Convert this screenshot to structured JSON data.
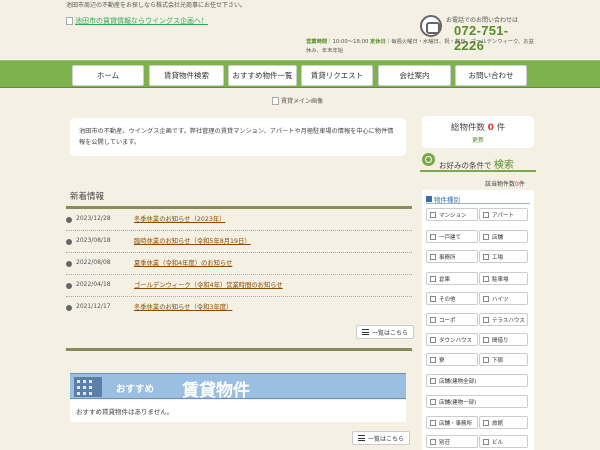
{
  "header": {
    "tagline": "池田市周辺の不動産をお探しなら株式会社光商事にお任せ下さい。",
    "logo_alt": "池田市の賃貸情報ならウイングス企画へ！",
    "phone_label": "お電話でのお問い合わせは",
    "phone_number": "072-751-2226",
    "hours_label": "営業時間",
    "hours_value": "10:00～18:00",
    "closed_label": "定休日",
    "closed_value": "毎週火曜日・水曜日、祝・祭日、ゴールデンウィーク、お盆休み、年末年始"
  },
  "nav": {
    "items": [
      "ホーム",
      "賃貸物件検索",
      "おすすめ物件一覧",
      "賃貸リクエスト",
      "会社案内",
      "お問い合わせ"
    ]
  },
  "hero": {
    "alt": "賃貸メイン画像"
  },
  "intro": {
    "text": "池田市の不動産、ウイングス企画です。弊社管理の賃貸マンション、アパートや月極駐車場の情報を中心に物件情報を公開しています。"
  },
  "news": {
    "title": "新着情報",
    "items": [
      {
        "date": "2023/12/28",
        "text": "冬季休業のお知らせ（2023年）"
      },
      {
        "date": "2023/08/18",
        "text": "臨時休業のお知らせ（令和5年8月19日）"
      },
      {
        "date": "2022/08/08",
        "text": "夏季休業（令和4年度）のお知らせ"
      },
      {
        "date": "2022/04/18",
        "text": "ゴールデンウィーク（令和4年）営業時間のお知らせ"
      },
      {
        "date": "2021/12/17",
        "text": "冬季休業のお知らせ（令和3年度）"
      }
    ],
    "more_label": "一覧はこちら"
  },
  "recommend": {
    "banner_small": "おすすめ",
    "banner_big": "賃貸物件",
    "empty_text": "おすすめ賃貸物件はありません。",
    "more_label": "一覧はこちら"
  },
  "sidebar": {
    "total_label": "総物件数",
    "total_value": "0",
    "total_unit": "件",
    "update_label": "更新",
    "search_prefix": "お好みの条件で",
    "search_big": "検索",
    "result_label": "該当物件数",
    "result_value": "0",
    "result_unit": "件",
    "type_title": "物件種別",
    "types": [
      "マンション",
      "アパート",
      "一戸建て",
      "店舗",
      "事務所",
      "工場",
      "倉庫",
      "駐車場",
      "その他",
      "ハイツ",
      "コーポ",
      "テラスハウス",
      "タウンハウス",
      "間借り",
      "寮",
      "下宿",
      "店舗(建物全部)",
      "店舗(建物一部)",
      "店舗・事務所",
      "旅館",
      "別荘",
      "ビル"
    ]
  },
  "colors": {
    "nav_green": "#7db24f",
    "accent_green": "#5a8a2e",
    "alert_red": "#dd3333",
    "banner_blue": "#9bbfe0"
  }
}
